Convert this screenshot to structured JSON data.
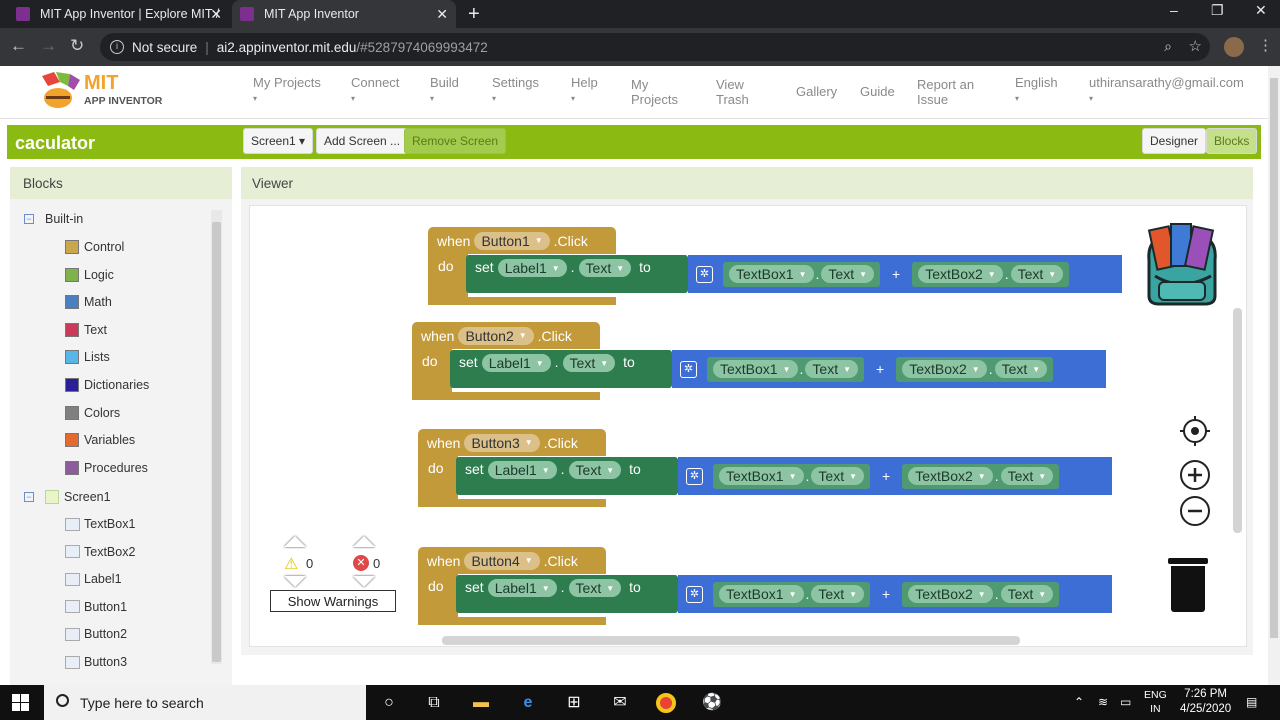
{
  "browser": {
    "tabs": [
      {
        "title": "MIT App Inventor | Explore MIT /",
        "close": "✕"
      },
      {
        "title": "MIT App Inventor",
        "close": "✕"
      }
    ],
    "new_tab": "+",
    "window_controls": [
      "–",
      "❐",
      "✕"
    ],
    "security": "Not secure",
    "url_host": "ai2.appinventor.mit.edu",
    "url_path": "/#5287974069993472"
  },
  "app": {
    "logo_top": "MIT",
    "logo_bottom": "APP INVENTOR",
    "menu": [
      {
        "label": "My Projects",
        "caret": "▾"
      },
      {
        "label": "Connect",
        "caret": "▾"
      },
      {
        "label": "Build",
        "caret": "▾"
      },
      {
        "label": "Settings",
        "caret": "▾"
      },
      {
        "label": "Help",
        "caret": "▾"
      },
      {
        "label": "My\nProjects"
      },
      {
        "label": "View\nTrash"
      },
      {
        "label": "Gallery"
      },
      {
        "label": "Guide"
      },
      {
        "label": "Report an\nIssue"
      },
      {
        "label": "English",
        "caret": "▾"
      },
      {
        "label": "uthiransarathy@gmail.com",
        "caret": "▾"
      }
    ],
    "project_name": "caculator",
    "toolbar": {
      "screen_select": "Screen1 ▾",
      "add_screen": "Add Screen ...",
      "remove_screen": "Remove Screen",
      "designer": "Designer",
      "blocks": "Blocks"
    }
  },
  "blocks_panel": {
    "title": "Blocks",
    "builtin_label": "Built-in",
    "builtin": [
      {
        "label": "Control",
        "color": "#c8a84b"
      },
      {
        "label": "Logic",
        "color": "#7fb24a"
      },
      {
        "label": "Math",
        "color": "#4a7fc1"
      },
      {
        "label": "Text",
        "color": "#c93a5b"
      },
      {
        "label": "Lists",
        "color": "#58b6e6"
      },
      {
        "label": "Dictionaries",
        "color": "#2a1f99"
      },
      {
        "label": "Colors",
        "color": "#808080"
      },
      {
        "label": "Variables",
        "color": "#e56a2f"
      },
      {
        "label": "Procedures",
        "color": "#8c5c9c"
      }
    ],
    "screen_label": "Screen1",
    "components": [
      "TextBox1",
      "TextBox2",
      "Label1",
      "Button1",
      "Button2",
      "Button3"
    ]
  },
  "viewer": {
    "title": "Viewer",
    "events": [
      {
        "when": "when",
        "component": "Button1",
        "event": ".Click",
        "do": "do",
        "set": "set",
        "target": "Label1",
        "prop": "Text",
        "to": "to",
        "a": "TextBox1",
        "a_prop": "Text",
        "op": "+",
        "b": "TextBox2",
        "b_prop": "Text"
      },
      {
        "when": "when",
        "component": "Button2",
        "event": ".Click",
        "do": "do",
        "set": "set",
        "target": "Label1",
        "prop": "Text",
        "to": "to",
        "a": "TextBox1",
        "a_prop": "Text",
        "op": "+",
        "b": "TextBox2",
        "b_prop": "Text"
      },
      {
        "when": "when",
        "component": "Button3",
        "event": ".Click",
        "do": "do",
        "set": "set",
        "target": "Label1",
        "prop": "Text",
        "to": "to",
        "a": "TextBox1",
        "a_prop": "Text",
        "op": "+",
        "b": "TextBox2",
        "b_prop": "Text"
      },
      {
        "when": "when",
        "component": "Button4",
        "event": ".Click",
        "do": "do",
        "set": "set",
        "target": "Label1",
        "prop": "Text",
        "to": "to",
        "a": "TextBox1",
        "a_prop": "Text",
        "op": "+",
        "b": "TextBox2",
        "b_prop": "Text"
      }
    ],
    "warnings_count": "0",
    "errors_count": "0",
    "show_warnings": "Show Warnings"
  },
  "taskbar": {
    "search_placeholder": "Type here to search",
    "lang_top": "ENG",
    "lang_bottom": "IN",
    "time": "7:26 PM",
    "date": "4/25/2020"
  }
}
